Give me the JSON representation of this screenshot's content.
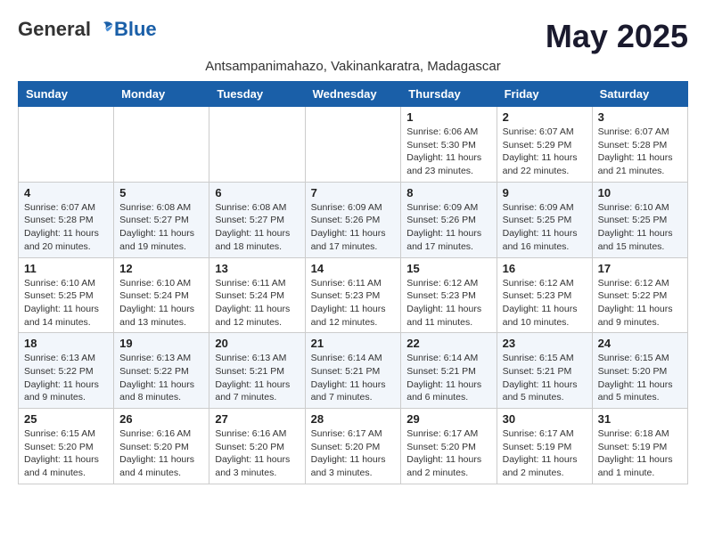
{
  "header": {
    "logo_general": "General",
    "logo_blue": "Blue",
    "month_title": "May 2025",
    "subtitle": "Antsampanimahazo, Vakinankaratra, Madagascar"
  },
  "days_of_week": [
    "Sunday",
    "Monday",
    "Tuesday",
    "Wednesday",
    "Thursday",
    "Friday",
    "Saturday"
  ],
  "weeks": [
    [
      {
        "day": "",
        "info": ""
      },
      {
        "day": "",
        "info": ""
      },
      {
        "day": "",
        "info": ""
      },
      {
        "day": "",
        "info": ""
      },
      {
        "day": "1",
        "sunrise": "6:06 AM",
        "sunset": "5:30 PM",
        "daylight": "11 hours and 23 minutes."
      },
      {
        "day": "2",
        "sunrise": "6:07 AM",
        "sunset": "5:29 PM",
        "daylight": "11 hours and 22 minutes."
      },
      {
        "day": "3",
        "sunrise": "6:07 AM",
        "sunset": "5:28 PM",
        "daylight": "11 hours and 21 minutes."
      }
    ],
    [
      {
        "day": "4",
        "sunrise": "6:07 AM",
        "sunset": "5:28 PM",
        "daylight": "11 hours and 20 minutes."
      },
      {
        "day": "5",
        "sunrise": "6:08 AM",
        "sunset": "5:27 PM",
        "daylight": "11 hours and 19 minutes."
      },
      {
        "day": "6",
        "sunrise": "6:08 AM",
        "sunset": "5:27 PM",
        "daylight": "11 hours and 18 minutes."
      },
      {
        "day": "7",
        "sunrise": "6:09 AM",
        "sunset": "5:26 PM",
        "daylight": "11 hours and 17 minutes."
      },
      {
        "day": "8",
        "sunrise": "6:09 AM",
        "sunset": "5:26 PM",
        "daylight": "11 hours and 17 minutes."
      },
      {
        "day": "9",
        "sunrise": "6:09 AM",
        "sunset": "5:25 PM",
        "daylight": "11 hours and 16 minutes."
      },
      {
        "day": "10",
        "sunrise": "6:10 AM",
        "sunset": "5:25 PM",
        "daylight": "11 hours and 15 minutes."
      }
    ],
    [
      {
        "day": "11",
        "sunrise": "6:10 AM",
        "sunset": "5:25 PM",
        "daylight": "11 hours and 14 minutes."
      },
      {
        "day": "12",
        "sunrise": "6:10 AM",
        "sunset": "5:24 PM",
        "daylight": "11 hours and 13 minutes."
      },
      {
        "day": "13",
        "sunrise": "6:11 AM",
        "sunset": "5:24 PM",
        "daylight": "11 hours and 12 minutes."
      },
      {
        "day": "14",
        "sunrise": "6:11 AM",
        "sunset": "5:23 PM",
        "daylight": "11 hours and 12 minutes."
      },
      {
        "day": "15",
        "sunrise": "6:12 AM",
        "sunset": "5:23 PM",
        "daylight": "11 hours and 11 minutes."
      },
      {
        "day": "16",
        "sunrise": "6:12 AM",
        "sunset": "5:23 PM",
        "daylight": "11 hours and 10 minutes."
      },
      {
        "day": "17",
        "sunrise": "6:12 AM",
        "sunset": "5:22 PM",
        "daylight": "11 hours and 9 minutes."
      }
    ],
    [
      {
        "day": "18",
        "sunrise": "6:13 AM",
        "sunset": "5:22 PM",
        "daylight": "11 hours and 9 minutes."
      },
      {
        "day": "19",
        "sunrise": "6:13 AM",
        "sunset": "5:22 PM",
        "daylight": "11 hours and 8 minutes."
      },
      {
        "day": "20",
        "sunrise": "6:13 AM",
        "sunset": "5:21 PM",
        "daylight": "11 hours and 7 minutes."
      },
      {
        "day": "21",
        "sunrise": "6:14 AM",
        "sunset": "5:21 PM",
        "daylight": "11 hours and 7 minutes."
      },
      {
        "day": "22",
        "sunrise": "6:14 AM",
        "sunset": "5:21 PM",
        "daylight": "11 hours and 6 minutes."
      },
      {
        "day": "23",
        "sunrise": "6:15 AM",
        "sunset": "5:21 PM",
        "daylight": "11 hours and 5 minutes."
      },
      {
        "day": "24",
        "sunrise": "6:15 AM",
        "sunset": "5:20 PM",
        "daylight": "11 hours and 5 minutes."
      }
    ],
    [
      {
        "day": "25",
        "sunrise": "6:15 AM",
        "sunset": "5:20 PM",
        "daylight": "11 hours and 4 minutes."
      },
      {
        "day": "26",
        "sunrise": "6:16 AM",
        "sunset": "5:20 PM",
        "daylight": "11 hours and 4 minutes."
      },
      {
        "day": "27",
        "sunrise": "6:16 AM",
        "sunset": "5:20 PM",
        "daylight": "11 hours and 3 minutes."
      },
      {
        "day": "28",
        "sunrise": "6:17 AM",
        "sunset": "5:20 PM",
        "daylight": "11 hours and 3 minutes."
      },
      {
        "day": "29",
        "sunrise": "6:17 AM",
        "sunset": "5:20 PM",
        "daylight": "11 hours and 2 minutes."
      },
      {
        "day": "30",
        "sunrise": "6:17 AM",
        "sunset": "5:19 PM",
        "daylight": "11 hours and 2 minutes."
      },
      {
        "day": "31",
        "sunrise": "6:18 AM",
        "sunset": "5:19 PM",
        "daylight": "11 hours and 1 minute."
      }
    ]
  ]
}
